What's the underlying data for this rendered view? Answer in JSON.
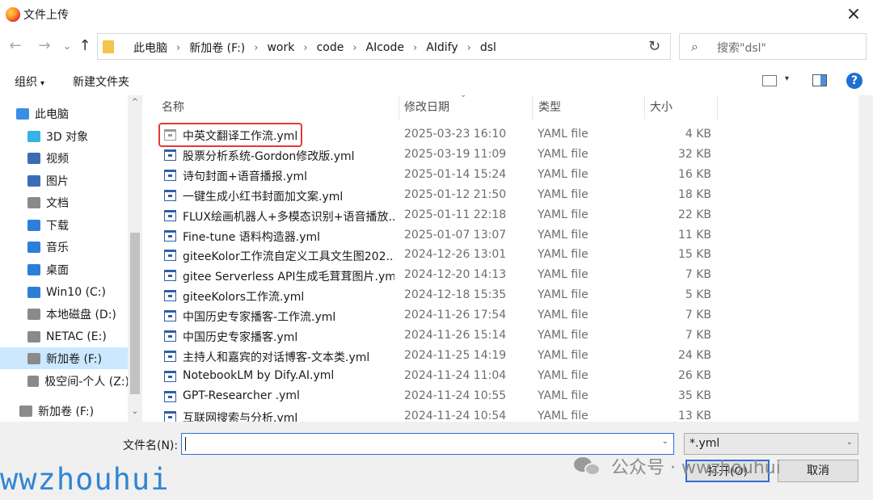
{
  "window": {
    "title": "文件上传",
    "close": "×"
  },
  "nav": {
    "back": "←",
    "forward": "→",
    "dropdown": "⌄",
    "up": "↑"
  },
  "address": {
    "crumbs": [
      "此电脑",
      "新加卷 (F:)",
      "work",
      "code",
      "AIcode",
      "AIdify",
      "dsl"
    ],
    "separator": "›",
    "dropdown": "⌄",
    "refresh": "↻"
  },
  "search": {
    "placeholder": "搜索\"dsl\"",
    "icon": "⌕"
  },
  "toolbar": {
    "organize": "组织",
    "organize_caret": "▾",
    "new_folder": "新建文件夹",
    "view_caret": "▾",
    "help": "?"
  },
  "sidebar": {
    "items": [
      {
        "label": "此电脑",
        "icon": "computer-icon",
        "color": "#3a8ee6"
      },
      {
        "label": "3D 对象",
        "icon": "cube-icon",
        "color": "#34b3e4"
      },
      {
        "label": "视频",
        "icon": "video-icon",
        "color": "#3b6db5"
      },
      {
        "label": "图片",
        "icon": "picture-icon",
        "color": "#3b6db5"
      },
      {
        "label": "文档",
        "icon": "document-icon",
        "color": "#8a8a8a"
      },
      {
        "label": "下载",
        "icon": "download-icon",
        "color": "#2b7fd9"
      },
      {
        "label": "音乐",
        "icon": "music-icon",
        "color": "#2b7fd9"
      },
      {
        "label": "桌面",
        "icon": "desktop-icon",
        "color": "#2b7fd9"
      },
      {
        "label": "Win10 (C:)",
        "icon": "windows-drive-icon",
        "color": "#2b7fd9"
      },
      {
        "label": "本地磁盘 (D:)",
        "icon": "drive-icon",
        "color": "#8a8a8a"
      },
      {
        "label": "NETAC (E:)",
        "icon": "drive-icon",
        "color": "#8a8a8a"
      },
      {
        "label": "新加卷 (F:)",
        "icon": "drive-icon",
        "color": "#8a8a8a"
      },
      {
        "label": "极空间-个人 (Z:)",
        "icon": "network-drive-icon",
        "color": "#8a8a8a"
      },
      {
        "label": "新加卷 (F:)",
        "icon": "drive-icon",
        "color": "#8a8a8a"
      }
    ],
    "scroll_up": "^",
    "scroll_down": "⌄"
  },
  "columns": {
    "name": "名称",
    "date": "修改日期",
    "type": "类型",
    "size": "大小",
    "sort_caret": "⌄"
  },
  "files": [
    {
      "name": "中英文翻译工作流.yml",
      "date": "2025-03-23 16:10",
      "type": "YAML file",
      "size": "4 KB"
    },
    {
      "name": "股票分析系统-Gordon修改版.yml",
      "date": "2025-03-19 11:09",
      "type": "YAML file",
      "size": "32 KB"
    },
    {
      "name": "诗句封面+语音播报.yml",
      "date": "2025-01-14 15:24",
      "type": "YAML file",
      "size": "16 KB"
    },
    {
      "name": "一键生成小红书封面加文案.yml",
      "date": "2025-01-12 21:50",
      "type": "YAML file",
      "size": "18 KB"
    },
    {
      "name": "FLUX绘画机器人+多模态识别+语音播放...",
      "date": "2025-01-11 22:18",
      "type": "YAML file",
      "size": "22 KB"
    },
    {
      "name": "Fine-tune 语料构造器.yml",
      "date": "2025-01-07 13:07",
      "type": "YAML file",
      "size": "11 KB"
    },
    {
      "name": "giteeKolor工作流自定义工具文生图202...",
      "date": "2024-12-26 13:01",
      "type": "YAML file",
      "size": "15 KB"
    },
    {
      "name": "gitee Serverless API生成毛茸茸图片.yml",
      "date": "2024-12-20 14:13",
      "type": "YAML file",
      "size": "7 KB"
    },
    {
      "name": "giteeKolors工作流.yml",
      "date": "2024-12-18 15:35",
      "type": "YAML file",
      "size": "5 KB"
    },
    {
      "name": "中国历史专家播客-工作流.yml",
      "date": "2024-11-26 17:54",
      "type": "YAML file",
      "size": "7 KB"
    },
    {
      "name": "中国历史专家播客.yml",
      "date": "2024-11-26 15:14",
      "type": "YAML file",
      "size": "7 KB"
    },
    {
      "name": "主持人和嘉宾的对话博客-文本类.yml",
      "date": "2024-11-25 14:19",
      "type": "YAML file",
      "size": "24 KB"
    },
    {
      "name": "NotebookLM by Dify.AI.yml",
      "date": "2024-11-24 11:04",
      "type": "YAML file",
      "size": "26 KB"
    },
    {
      "name": "GPT-Researcher .yml",
      "date": "2024-11-24 10:55",
      "type": "YAML file",
      "size": "35 KB"
    },
    {
      "name": "互联网搜索与分析.yml",
      "date": "2024-11-24 10:54",
      "type": "YAML file",
      "size": "13 KB"
    }
  ],
  "footer": {
    "filename_label": "文件名(N):",
    "filename_value": "",
    "filename_dropdown": "⌄",
    "filter_value": "*.yml",
    "filter_dropdown": "⌄",
    "open": "打开(O)",
    "cancel": "取消"
  },
  "overlay": {
    "watermark": "wwzhouhui",
    "wechat": "公众号 · wwzhouhui"
  },
  "colors": {
    "accent": "#2d6fd2",
    "selection": "#cce8ff",
    "highlight_box": "#e53935"
  }
}
